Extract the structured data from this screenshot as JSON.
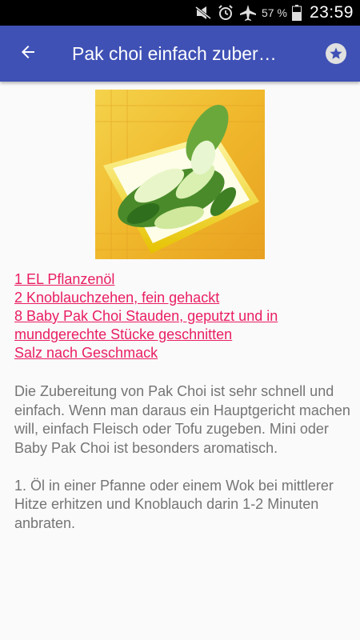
{
  "status_bar": {
    "icons": [
      "mute-icon",
      "alarm-icon",
      "airplane-mode-icon",
      "battery-icon"
    ],
    "battery_percent": "57 %",
    "time": "23:59"
  },
  "toolbar": {
    "title": "Pak choi einfach zuber…",
    "back_icon": "arrow-back-icon",
    "favorite_icon": "star-icon"
  },
  "recipe": {
    "image_alt": "pak-choi-dish-photo",
    "ingredients": [
      "1 EL Pflanzenöl",
      "2 Knoblauchzehen, fein gehackt",
      "8 Baby Pak Choi Stauden, geputzt und in mundgerechte Stücke geschnitten",
      "Salz nach Geschmack"
    ],
    "instructions": "Die Zubereitung von Pak Choi ist sehr schnell und einfach. Wenn man daraus ein Hauptgericht machen will, einfach Fleisch oder Tofu zugeben. Mini oder Baby Pak Choi ist besonders aromatisch.\n\n1. Öl in einer Pfanne oder einem Wok bei mittlerer Hitze erhitzen und Knoblauch darin 1-2 Minuten anbraten."
  },
  "colors": {
    "app_bar": "#3f51b5",
    "link": "#e91e63",
    "body_text": "#757575"
  }
}
